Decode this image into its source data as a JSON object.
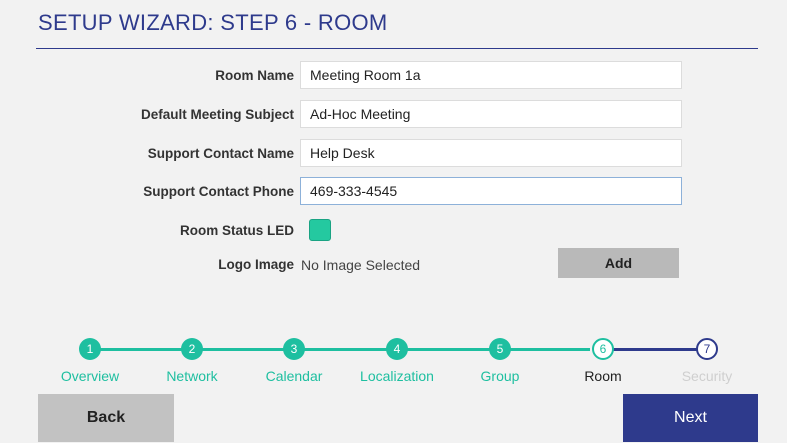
{
  "title": "SETUP WIZARD: STEP 6 - ROOM",
  "form": {
    "room_name_label": "Room Name",
    "room_name_value": "Meeting Room 1a",
    "subject_label": "Default Meeting Subject",
    "subject_value": "Ad-Hoc Meeting",
    "contact_name_label": "Support Contact Name",
    "contact_name_value": "Help Desk",
    "contact_phone_label": "Support Contact Phone",
    "contact_phone_value": "469-333-4545",
    "led_label": "Room Status LED",
    "led_color": "#24c9a0",
    "logo_label": "Logo Image",
    "logo_value": "No Image Selected",
    "add_label": "Add"
  },
  "steps": [
    {
      "num": "1",
      "label": "Overview",
      "state": "done"
    },
    {
      "num": "2",
      "label": "Network",
      "state": "done"
    },
    {
      "num": "3",
      "label": "Calendar",
      "state": "done"
    },
    {
      "num": "4",
      "label": "Localization",
      "state": "done"
    },
    {
      "num": "5",
      "label": "Group",
      "state": "done"
    },
    {
      "num": "6",
      "label": "Room",
      "state": "current"
    },
    {
      "num": "7",
      "label": "Security",
      "state": "future"
    }
  ],
  "nav": {
    "back_label": "Back",
    "next_label": "Next"
  },
  "colors": {
    "accent_teal": "#1ebfa0",
    "brand_blue": "#2e3a8c"
  }
}
